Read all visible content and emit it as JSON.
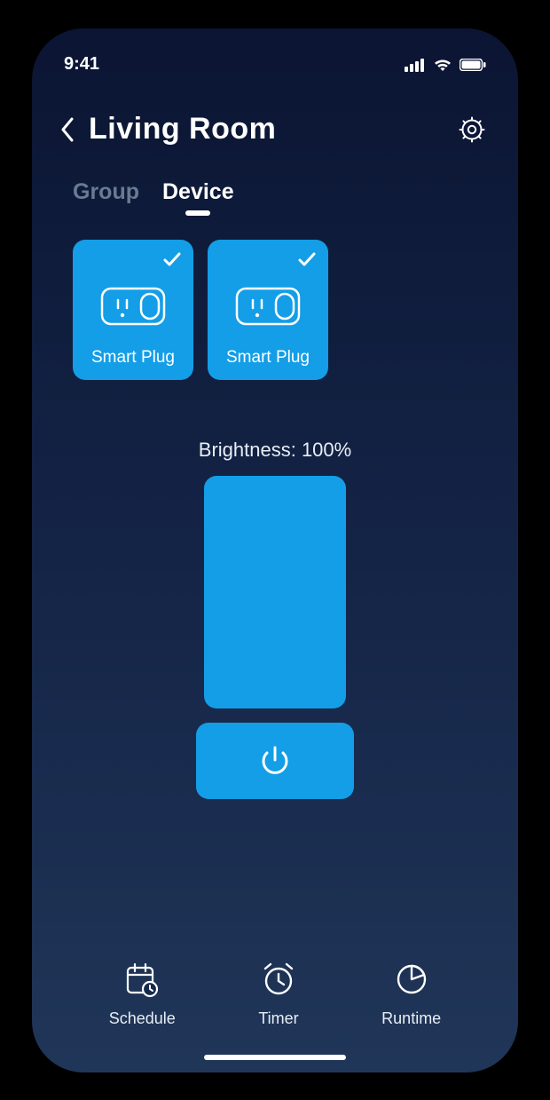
{
  "status": {
    "time": "9:41"
  },
  "header": {
    "title": "Living Room"
  },
  "tabs": [
    {
      "label": "Group",
      "active": false
    },
    {
      "label": "Device",
      "active": true
    }
  ],
  "devices": [
    {
      "label": "Smart Plug",
      "checked": true
    },
    {
      "label": "Smart Plug",
      "checked": true
    }
  ],
  "brightness": {
    "labelPrefix": "Brightness: ",
    "value": 100,
    "display": "Brightness: 100%"
  },
  "bottomNav": [
    {
      "label": "Schedule"
    },
    {
      "label": "Timer"
    },
    {
      "label": "Runtime"
    }
  ],
  "colors": {
    "accent": "#139ee7",
    "bgTop": "#0b1533",
    "bgBottom": "#203658"
  }
}
